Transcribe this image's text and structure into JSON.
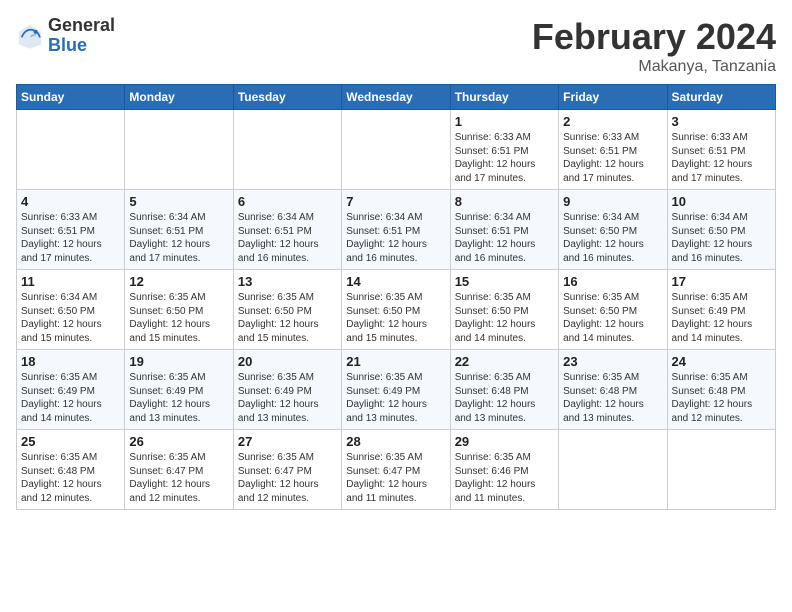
{
  "header": {
    "logo_general": "General",
    "logo_blue": "Blue",
    "month_year": "February 2024",
    "location": "Makanya, Tanzania"
  },
  "days_of_week": [
    "Sunday",
    "Monday",
    "Tuesday",
    "Wednesday",
    "Thursday",
    "Friday",
    "Saturday"
  ],
  "weeks": [
    [
      {
        "num": "",
        "info": ""
      },
      {
        "num": "",
        "info": ""
      },
      {
        "num": "",
        "info": ""
      },
      {
        "num": "",
        "info": ""
      },
      {
        "num": "1",
        "info": "Sunrise: 6:33 AM\nSunset: 6:51 PM\nDaylight: 12 hours\nand 17 minutes."
      },
      {
        "num": "2",
        "info": "Sunrise: 6:33 AM\nSunset: 6:51 PM\nDaylight: 12 hours\nand 17 minutes."
      },
      {
        "num": "3",
        "info": "Sunrise: 6:33 AM\nSunset: 6:51 PM\nDaylight: 12 hours\nand 17 minutes."
      }
    ],
    [
      {
        "num": "4",
        "info": "Sunrise: 6:33 AM\nSunset: 6:51 PM\nDaylight: 12 hours\nand 17 minutes."
      },
      {
        "num": "5",
        "info": "Sunrise: 6:34 AM\nSunset: 6:51 PM\nDaylight: 12 hours\nand 17 minutes."
      },
      {
        "num": "6",
        "info": "Sunrise: 6:34 AM\nSunset: 6:51 PM\nDaylight: 12 hours\nand 16 minutes."
      },
      {
        "num": "7",
        "info": "Sunrise: 6:34 AM\nSunset: 6:51 PM\nDaylight: 12 hours\nand 16 minutes."
      },
      {
        "num": "8",
        "info": "Sunrise: 6:34 AM\nSunset: 6:51 PM\nDaylight: 12 hours\nand 16 minutes."
      },
      {
        "num": "9",
        "info": "Sunrise: 6:34 AM\nSunset: 6:50 PM\nDaylight: 12 hours\nand 16 minutes."
      },
      {
        "num": "10",
        "info": "Sunrise: 6:34 AM\nSunset: 6:50 PM\nDaylight: 12 hours\nand 16 minutes."
      }
    ],
    [
      {
        "num": "11",
        "info": "Sunrise: 6:34 AM\nSunset: 6:50 PM\nDaylight: 12 hours\nand 15 minutes."
      },
      {
        "num": "12",
        "info": "Sunrise: 6:35 AM\nSunset: 6:50 PM\nDaylight: 12 hours\nand 15 minutes."
      },
      {
        "num": "13",
        "info": "Sunrise: 6:35 AM\nSunset: 6:50 PM\nDaylight: 12 hours\nand 15 minutes."
      },
      {
        "num": "14",
        "info": "Sunrise: 6:35 AM\nSunset: 6:50 PM\nDaylight: 12 hours\nand 15 minutes."
      },
      {
        "num": "15",
        "info": "Sunrise: 6:35 AM\nSunset: 6:50 PM\nDaylight: 12 hours\nand 14 minutes."
      },
      {
        "num": "16",
        "info": "Sunrise: 6:35 AM\nSunset: 6:50 PM\nDaylight: 12 hours\nand 14 minutes."
      },
      {
        "num": "17",
        "info": "Sunrise: 6:35 AM\nSunset: 6:49 PM\nDaylight: 12 hours\nand 14 minutes."
      }
    ],
    [
      {
        "num": "18",
        "info": "Sunrise: 6:35 AM\nSunset: 6:49 PM\nDaylight: 12 hours\nand 14 minutes."
      },
      {
        "num": "19",
        "info": "Sunrise: 6:35 AM\nSunset: 6:49 PM\nDaylight: 12 hours\nand 13 minutes."
      },
      {
        "num": "20",
        "info": "Sunrise: 6:35 AM\nSunset: 6:49 PM\nDaylight: 12 hours\nand 13 minutes."
      },
      {
        "num": "21",
        "info": "Sunrise: 6:35 AM\nSunset: 6:49 PM\nDaylight: 12 hours\nand 13 minutes."
      },
      {
        "num": "22",
        "info": "Sunrise: 6:35 AM\nSunset: 6:48 PM\nDaylight: 12 hours\nand 13 minutes."
      },
      {
        "num": "23",
        "info": "Sunrise: 6:35 AM\nSunset: 6:48 PM\nDaylight: 12 hours\nand 13 minutes."
      },
      {
        "num": "24",
        "info": "Sunrise: 6:35 AM\nSunset: 6:48 PM\nDaylight: 12 hours\nand 12 minutes."
      }
    ],
    [
      {
        "num": "25",
        "info": "Sunrise: 6:35 AM\nSunset: 6:48 PM\nDaylight: 12 hours\nand 12 minutes."
      },
      {
        "num": "26",
        "info": "Sunrise: 6:35 AM\nSunset: 6:47 PM\nDaylight: 12 hours\nand 12 minutes."
      },
      {
        "num": "27",
        "info": "Sunrise: 6:35 AM\nSunset: 6:47 PM\nDaylight: 12 hours\nand 12 minutes."
      },
      {
        "num": "28",
        "info": "Sunrise: 6:35 AM\nSunset: 6:47 PM\nDaylight: 12 hours\nand 11 minutes."
      },
      {
        "num": "29",
        "info": "Sunrise: 6:35 AM\nSunset: 6:46 PM\nDaylight: 12 hours\nand 11 minutes."
      },
      {
        "num": "",
        "info": ""
      },
      {
        "num": "",
        "info": ""
      }
    ]
  ]
}
